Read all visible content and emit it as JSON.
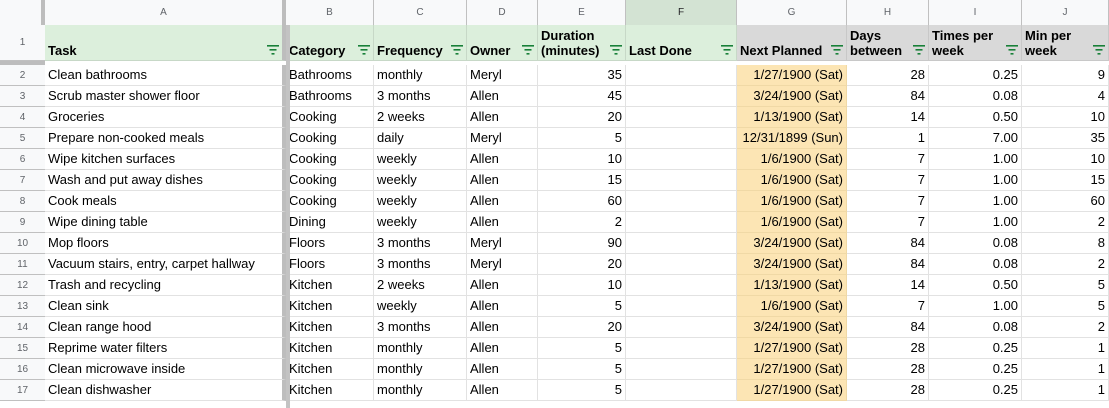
{
  "column_letters": [
    "A",
    "B",
    "C",
    "D",
    "E",
    "F",
    "G",
    "H",
    "I",
    "J"
  ],
  "header_row_number": "1",
  "headers": [
    "Task",
    "Category",
    "Frequency",
    "Owner",
    "Duration (minutes)",
    "Last Done",
    "Next Planned",
    "Days between",
    "Times per week",
    "Min per week"
  ],
  "rows": [
    {
      "n": "2",
      "task": "Clean bathrooms",
      "category": "Bathrooms",
      "frequency": "monthly",
      "owner": "Meryl",
      "duration": "35",
      "last": "",
      "next": "1/27/1900 (Sat)",
      "days": "28",
      "times": "0.25",
      "min": "9"
    },
    {
      "n": "3",
      "task": "Scrub master shower floor",
      "category": "Bathrooms",
      "frequency": "3 months",
      "owner": "Allen",
      "duration": "45",
      "last": "",
      "next": "3/24/1900 (Sat)",
      "days": "84",
      "times": "0.08",
      "min": "4"
    },
    {
      "n": "4",
      "task": "Groceries",
      "category": "Cooking",
      "frequency": "2 weeks",
      "owner": "Allen",
      "duration": "20",
      "last": "",
      "next": "1/13/1900 (Sat)",
      "days": "14",
      "times": "0.50",
      "min": "10"
    },
    {
      "n": "5",
      "task": "Prepare non-cooked meals",
      "category": "Cooking",
      "frequency": "daily",
      "owner": "Meryl",
      "duration": "5",
      "last": "",
      "next": "12/31/1899 (Sun)",
      "days": "1",
      "times": "7.00",
      "min": "35"
    },
    {
      "n": "6",
      "task": "Wipe kitchen surfaces",
      "category": "Cooking",
      "frequency": "weekly",
      "owner": "Allen",
      "duration": "10",
      "last": "",
      "next": "1/6/1900 (Sat)",
      "days": "7",
      "times": "1.00",
      "min": "10"
    },
    {
      "n": "7",
      "task": "Wash and put away dishes",
      "category": "Cooking",
      "frequency": "weekly",
      "owner": "Allen",
      "duration": "15",
      "last": "",
      "next": "1/6/1900 (Sat)",
      "days": "7",
      "times": "1.00",
      "min": "15"
    },
    {
      "n": "8",
      "task": "Cook meals",
      "category": "Cooking",
      "frequency": "weekly",
      "owner": "Allen",
      "duration": "60",
      "last": "",
      "next": "1/6/1900 (Sat)",
      "days": "7",
      "times": "1.00",
      "min": "60"
    },
    {
      "n": "9",
      "task": "Wipe dining table",
      "category": "Dining",
      "frequency": "weekly",
      "owner": "Allen",
      "duration": "2",
      "last": "",
      "next": "1/6/1900 (Sat)",
      "days": "7",
      "times": "1.00",
      "min": "2"
    },
    {
      "n": "10",
      "task": "Mop floors",
      "category": "Floors",
      "frequency": "3 months",
      "owner": "Meryl",
      "duration": "90",
      "last": "",
      "next": "3/24/1900 (Sat)",
      "days": "84",
      "times": "0.08",
      "min": "8"
    },
    {
      "n": "11",
      "task": "Vacuum stairs, entry, carpet hallway",
      "category": "Floors",
      "frequency": "3 months",
      "owner": "Meryl",
      "duration": "20",
      "last": "",
      "next": "3/24/1900 (Sat)",
      "days": "84",
      "times": "0.08",
      "min": "2"
    },
    {
      "n": "12",
      "task": "Trash and recycling",
      "category": "Kitchen",
      "frequency": "2 weeks",
      "owner": "Allen",
      "duration": "10",
      "last": "",
      "next": "1/13/1900 (Sat)",
      "days": "14",
      "times": "0.50",
      "min": "5"
    },
    {
      "n": "13",
      "task": "Clean sink",
      "category": "Kitchen",
      "frequency": "weekly",
      "owner": "Allen",
      "duration": "5",
      "last": "",
      "next": "1/6/1900 (Sat)",
      "days": "7",
      "times": "1.00",
      "min": "5"
    },
    {
      "n": "14",
      "task": "Clean range hood",
      "category": "Kitchen",
      "frequency": "3 months",
      "owner": "Allen",
      "duration": "20",
      "last": "",
      "next": "3/24/1900 (Sat)",
      "days": "84",
      "times": "0.08",
      "min": "2"
    },
    {
      "n": "15",
      "task": "Reprime water filters",
      "category": "Kitchen",
      "frequency": "monthly",
      "owner": "Allen",
      "duration": "5",
      "last": "",
      "next": "1/27/1900 (Sat)",
      "days": "28",
      "times": "0.25",
      "min": "1"
    },
    {
      "n": "16",
      "task": "Clean microwave inside",
      "category": "Kitchen",
      "frequency": "monthly",
      "owner": "Allen",
      "duration": "5",
      "last": "",
      "next": "1/27/1900 (Sat)",
      "days": "28",
      "times": "0.25",
      "min": "1"
    },
    {
      "n": "17",
      "task": "Clean dishwasher",
      "category": "Kitchen",
      "frequency": "monthly",
      "owner": "Allen",
      "duration": "5",
      "last": "",
      "next": "1/27/1900 (Sat)",
      "days": "28",
      "times": "0.25",
      "min": "1"
    }
  ],
  "colors": {
    "header_green": "#dcefdc",
    "header_gray": "#d9d9d9",
    "next_planned_fill": "#fce5b4",
    "filter_icon": "#188038"
  }
}
